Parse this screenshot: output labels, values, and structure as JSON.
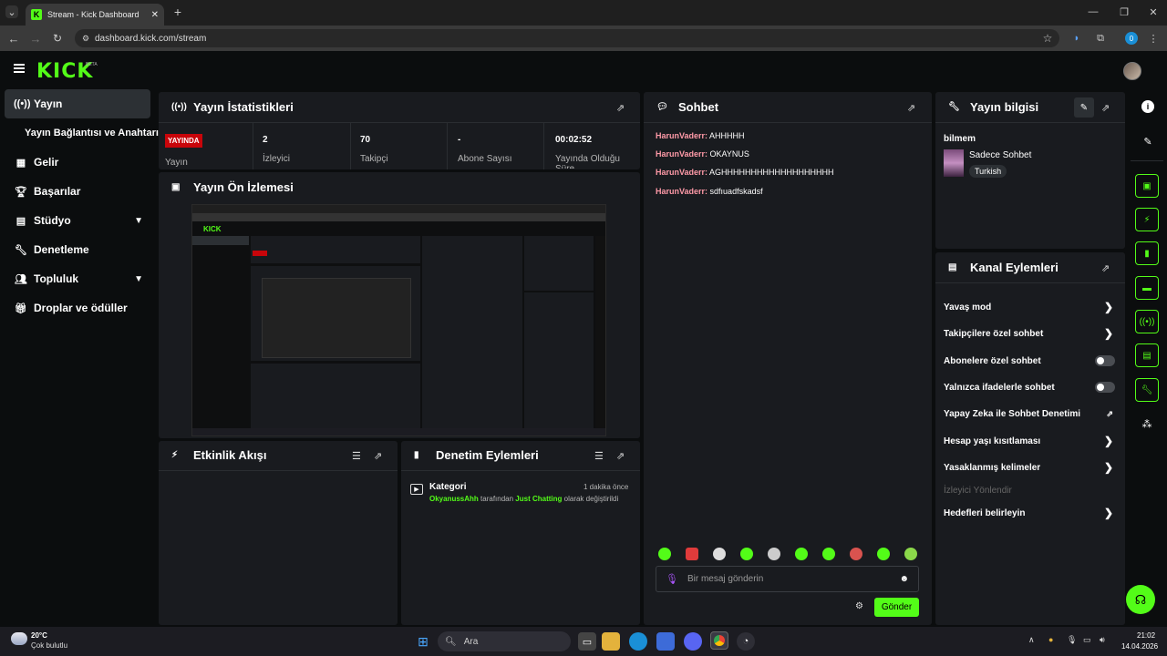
{
  "browser": {
    "tab_title": "Stream - Kick Dashboard",
    "url": "dashboard.kick.com/stream",
    "profile_letter": "0"
  },
  "app": {
    "logo": "KICK",
    "beta": "BETA"
  },
  "sidebar": {
    "items": [
      {
        "label": "Yayın",
        "icon": "broadcast-icon"
      },
      {
        "label": "Yayın Bağlantısı ve Anahtarı",
        "icon": ""
      },
      {
        "label": "Gelir",
        "icon": "revenue-icon"
      },
      {
        "label": "Başarılar",
        "icon": "trophy-icon"
      },
      {
        "label": "Stüdyo",
        "icon": "studio-icon"
      },
      {
        "label": "Denetleme",
        "icon": "wrench-icon"
      },
      {
        "label": "Topluluk",
        "icon": "community-icon"
      },
      {
        "label": "Droplar ve ödüller",
        "icon": "gift-icon"
      }
    ]
  },
  "stats": {
    "title": "Yayın İstatistikleri",
    "live_badge": "YAYINDA",
    "live_label": "Yayın",
    "viewers_value": "2",
    "viewers_label": "İzleyici",
    "followers_value": "70",
    "followers_label": "Takipçi",
    "subs_value": "-",
    "subs_label": "Abone Sayısı",
    "uptime_value": "00:02:52",
    "uptime_label": "Yayında Olduğu Süre"
  },
  "preview": {
    "title": "Yayın Ön İzlemesi"
  },
  "activity": {
    "title": "Etkinlik Akışı"
  },
  "moderation": {
    "title": "Denetim Eylemleri",
    "entry_title": "Kategori",
    "entry_time": "1 dakika önce",
    "entry_user": "OkyanussAhh",
    "entry_mid": "tarafından",
    "entry_category": "Just Chatting",
    "entry_end": "olarak değiştirildi"
  },
  "chat": {
    "title": "Sohbet",
    "messages": [
      {
        "user": "HarunVaderr:",
        "text": "AHHHHH"
      },
      {
        "user": "HarunVaderr:",
        "text": "OKAYNUS"
      },
      {
        "user": "HarunVaderr:",
        "text": "AGHHHHHHHHHHHHHHHHHHH"
      },
      {
        "user": "HarunVaderr:",
        "text": "sdfıuadfskadsf"
      }
    ],
    "placeholder": "Bir mesaj gönderin",
    "send_label": "Gönder"
  },
  "stream_info": {
    "title": "Yayın bilgisi",
    "stream_title": "bilmem",
    "category": "Sadece Sohbet",
    "language": "Turkish"
  },
  "channel_actions": {
    "title": "Kanal Eylemleri",
    "rows": [
      {
        "label": "Yavaş mod",
        "type": "chevron"
      },
      {
        "label": "Takipçilere özel sohbet",
        "type": "chevron"
      },
      {
        "label": "Abonelere özel sohbet",
        "type": "toggle"
      },
      {
        "label": "Yalnızca ifadelerle sohbet",
        "type": "toggle"
      },
      {
        "label": "Yapay Zeka ile Sohbet Denetimi",
        "type": "external"
      },
      {
        "label": "Hesap yaşı kısıtlaması",
        "type": "chevron"
      },
      {
        "label": "Yasaklanmış kelimeler",
        "type": "chevron"
      },
      {
        "label": "İzleyici Yönlendir",
        "type": "disabled"
      },
      {
        "label": "Hedefleri belirleyin",
        "type": "chevron"
      }
    ]
  },
  "taskbar": {
    "temp": "20°C",
    "weather": "Çok bulutlu",
    "search": "Ara",
    "time": "21:02",
    "date": "14.04.2026"
  },
  "colors": {
    "accent": "#53fc18",
    "panel": "#191b1f",
    "live": "#c8050a",
    "username": "#ff9aa8"
  }
}
